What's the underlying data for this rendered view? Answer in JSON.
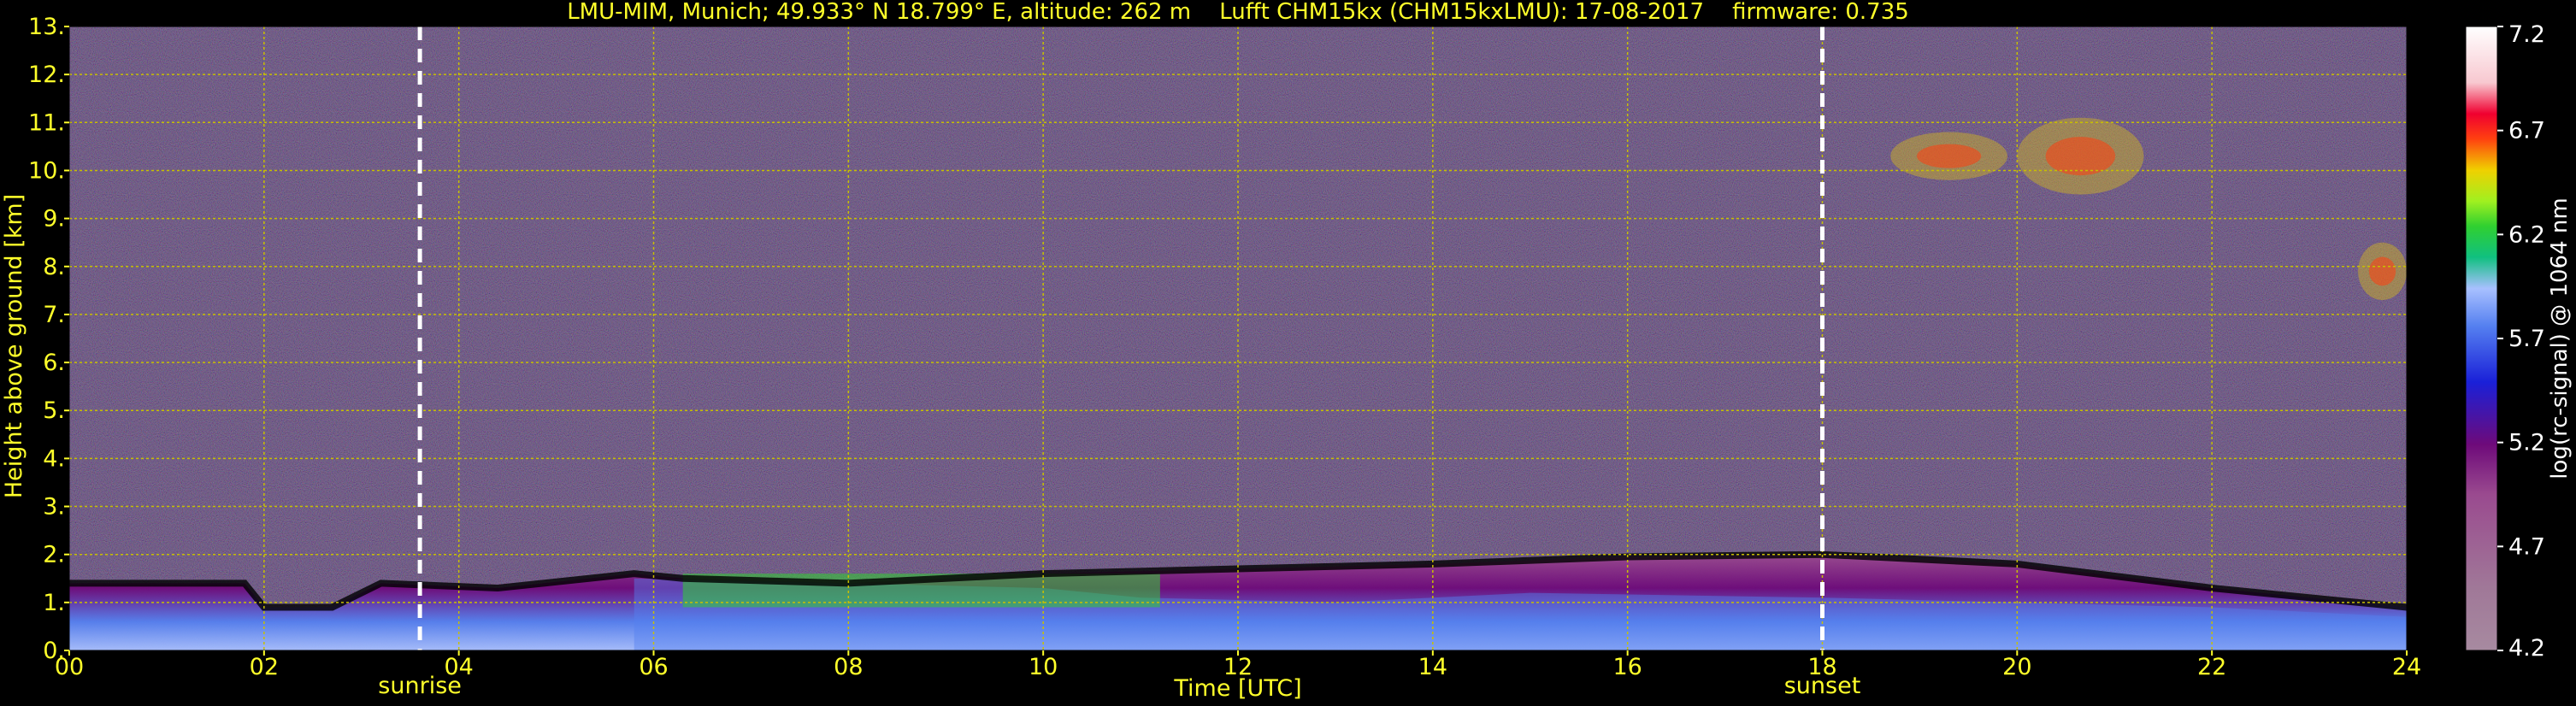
{
  "chart_data": {
    "type": "heatmap",
    "title": "LMU-MIM, Munich; 49.933° N 18.799° E, altitude: 262 m    Lufft CHM15kx (CHM15kxLMU): 17-08-2017    firmware: 0.735",
    "xlabel": "Time [UTC]",
    "ylabel": "Height above ground [km]",
    "colorbar_label": "log(rc-signal) @ 1064 nm",
    "xlim": [
      0,
      24
    ],
    "ylim": [
      0,
      13
    ],
    "x_ticks": [
      "00",
      "02",
      "04",
      "06",
      "08",
      "10",
      "12",
      "14",
      "16",
      "18",
      "20",
      "22",
      "24"
    ],
    "y_ticks": [
      "0.",
      "1.",
      "2.",
      "3.",
      "4.",
      "5.",
      "6.",
      "7.",
      "8.",
      "9.",
      "10.",
      "11.",
      "12.",
      "13."
    ],
    "colorbar_ticks": [
      "4.2",
      "4.7",
      "5.2",
      "5.7",
      "6.2",
      "6.7",
      "7.2"
    ],
    "colorbar_range": [
      4.2,
      7.2
    ],
    "grid": true,
    "events": [
      {
        "label": "sunrise",
        "time": 3.6
      },
      {
        "label": "sunset",
        "time": 18.0
      }
    ],
    "features": {
      "boundary_layer_top": [
        [
          0,
          1.4
        ],
        [
          1.8,
          1.4
        ],
        [
          2.0,
          0.9
        ],
        [
          2.7,
          0.9
        ],
        [
          3.2,
          1.4
        ],
        [
          4.4,
          1.3
        ],
        [
          5.8,
          1.6
        ],
        [
          6.3,
          1.5
        ],
        [
          8,
          1.4
        ],
        [
          10,
          1.6
        ],
        [
          12,
          1.7
        ],
        [
          14,
          1.8
        ],
        [
          16,
          1.95
        ],
        [
          18,
          2.0
        ],
        [
          20,
          1.8
        ],
        [
          22,
          1.3
        ],
        [
          24,
          0.9
        ]
      ],
      "cirrus_patches": [
        {
          "x": 18.7,
          "y": 9.8,
          "w": 1.2,
          "h": 1.0
        },
        {
          "x": 20.0,
          "y": 9.5,
          "w": 1.3,
          "h": 1.6
        },
        {
          "x": 23.5,
          "y": 7.3,
          "w": 0.5,
          "h": 1.2
        }
      ]
    },
    "colormap": [
      "#a78aa0",
      "#a07898",
      "#9a4a8f",
      "#6e0a7a",
      "#1a20d8",
      "#5580f0",
      "#a8c0ff",
      "#10c080",
      "#30d030",
      "#a0f020",
      "#f0d000",
      "#ff4010",
      "#f00030",
      "#ffffff"
    ]
  }
}
